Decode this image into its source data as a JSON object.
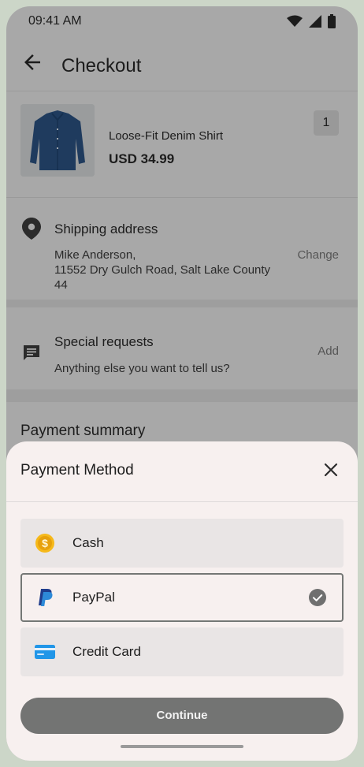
{
  "status_bar": {
    "time": "09:41 AM"
  },
  "app_bar": {
    "title": "Checkout"
  },
  "product": {
    "name": "Loose-Fit Denim Shirt",
    "price": "USD 34.99",
    "quantity": "1"
  },
  "shipping": {
    "title": "Shipping address",
    "name_line": "Mike Anderson,",
    "address_line": "11552 Dry Gulch Road, Salt Lake County",
    "zip_line": "44",
    "action": "Change"
  },
  "special_requests": {
    "title": "Special requests",
    "placeholder": "Anything else you want to tell us?",
    "action": "Add"
  },
  "payment_summary": {
    "title": "Payment summary"
  },
  "payment_sheet": {
    "title": "Payment Method",
    "options": [
      {
        "label": "Cash",
        "icon": "cash-coin-icon",
        "selected": false
      },
      {
        "label": "PayPal",
        "icon": "paypal-icon",
        "selected": true
      },
      {
        "label": "Credit Card",
        "icon": "credit-card-icon",
        "selected": false
      }
    ],
    "continue_label": "Continue"
  },
  "colors": {
    "accent": "#737473",
    "sheet_bg": "#f7f0ef",
    "scrim": "#a8a8a8",
    "frame": "#ccd6c8"
  }
}
